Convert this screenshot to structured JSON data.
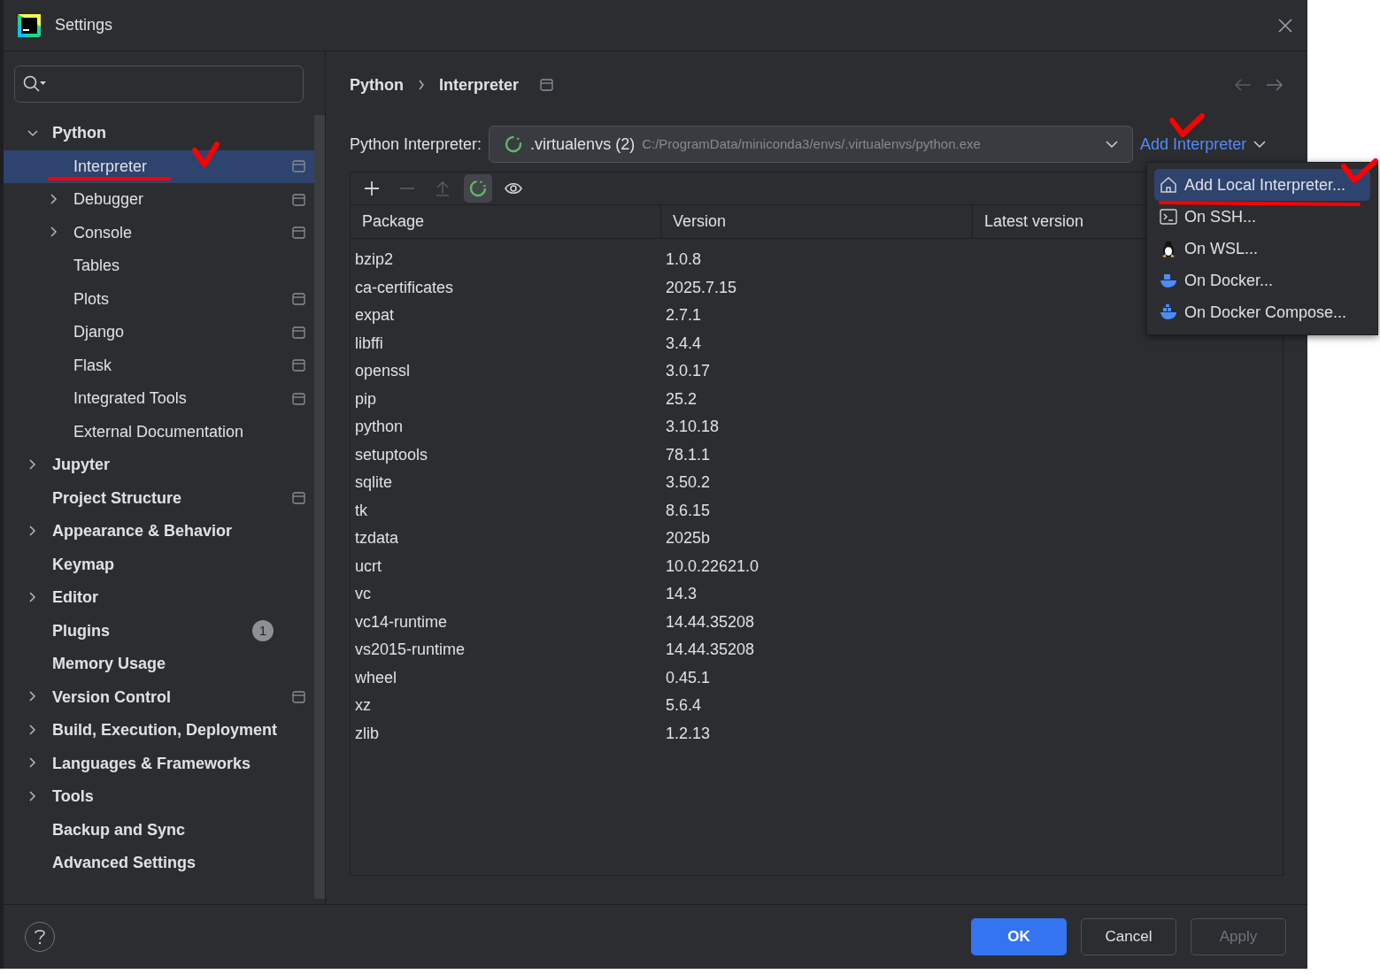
{
  "window": {
    "title": "Settings"
  },
  "sidebar": {
    "items": [
      {
        "label": "Python",
        "selected": false,
        "expanded": true,
        "project": false,
        "children": [
          {
            "label": "Interpreter",
            "selected": true,
            "project": true
          },
          {
            "label": "Debugger",
            "selected": false,
            "expanded": false,
            "project": true
          },
          {
            "label": "Console",
            "selected": false,
            "expanded": false,
            "project": true
          },
          {
            "label": "Tables",
            "selected": false,
            "project": false
          },
          {
            "label": "Plots",
            "selected": false,
            "project": true
          },
          {
            "label": "Django",
            "selected": false,
            "project": true
          },
          {
            "label": "Flask",
            "selected": false,
            "project": true
          },
          {
            "label": "Integrated Tools",
            "selected": false,
            "project": true
          },
          {
            "label": "External Documentation",
            "selected": false,
            "project": false
          }
        ]
      },
      {
        "label": "Jupyter",
        "selected": false,
        "expanded": false,
        "project": false
      },
      {
        "label": "Project Structure",
        "selected": false,
        "project": true
      },
      {
        "label": "Appearance & Behavior",
        "selected": false,
        "expanded": false,
        "project": false
      },
      {
        "label": "Keymap",
        "selected": false,
        "project": false
      },
      {
        "label": "Editor",
        "selected": false,
        "expanded": false,
        "project": false
      },
      {
        "label": "Plugins",
        "selected": false,
        "project": false,
        "badge": "1"
      },
      {
        "label": "Memory Usage",
        "selected": false,
        "project": false
      },
      {
        "label": "Version Control",
        "selected": false,
        "expanded": false,
        "project": true
      },
      {
        "label": "Build, Execution, Deployment",
        "selected": false,
        "expanded": false,
        "project": false
      },
      {
        "label": "Languages & Frameworks",
        "selected": false,
        "expanded": false,
        "project": false
      },
      {
        "label": "Tools",
        "selected": false,
        "expanded": false,
        "project": false
      },
      {
        "label": "Backup and Sync",
        "selected": false,
        "project": false
      },
      {
        "label": "Advanced Settings",
        "selected": false,
        "project": false
      }
    ]
  },
  "breadcrumb": [
    "Python",
    "Interpreter"
  ],
  "interpreter": {
    "label": "Python Interpreter:",
    "name": ".virtualenvs (2)",
    "path": "C:/ProgramData/miniconda3/envs/.virtualenvs/python.exe"
  },
  "add_interpreter": {
    "label": "Add Interpreter",
    "expanded": true
  },
  "menu": [
    {
      "kind": "home",
      "label": "Add Local Interpreter...",
      "selected": true
    },
    {
      "kind": "terminal",
      "label": "On SSH...",
      "selected": false
    },
    {
      "kind": "linux",
      "label": "On WSL...",
      "selected": false
    },
    {
      "kind": "docker",
      "label": "On Docker...",
      "selected": false
    },
    {
      "kind": "compose",
      "label": "On Docker Compose...",
      "selected": false
    }
  ],
  "toolbar": [
    {
      "kind": "add",
      "disabled": false,
      "on": false
    },
    {
      "kind": "remove",
      "disabled": true,
      "on": false
    },
    {
      "kind": "upgrade",
      "disabled": true,
      "on": false
    },
    {
      "kind": "refresh",
      "disabled": false,
      "on": true
    },
    {
      "kind": "eye",
      "disabled": false,
      "on": false
    }
  ],
  "table": {
    "columns": [
      "Package",
      "Version",
      "Latest version"
    ],
    "rows": [
      [
        "bzip2",
        "1.0.8"
      ],
      [
        "ca-certificates",
        "2025.7.15"
      ],
      [
        "expat",
        "2.7.1"
      ],
      [
        "libffi",
        "3.4.4"
      ],
      [
        "openssl",
        "3.0.17"
      ],
      [
        "pip",
        "25.2"
      ],
      [
        "python",
        "3.10.18"
      ],
      [
        "setuptools",
        "78.1.1"
      ],
      [
        "sqlite",
        "3.50.2"
      ],
      [
        "tk",
        "8.6.15"
      ],
      [
        "tzdata",
        "2025b"
      ],
      [
        "ucrt",
        "10.0.22621.0"
      ],
      [
        "vc",
        "14.3"
      ],
      [
        "vc14-runtime",
        "14.44.35208"
      ],
      [
        "vs2015-runtime",
        "14.44.35208"
      ],
      [
        "wheel",
        "0.45.1"
      ],
      [
        "xz",
        "5.6.4"
      ],
      [
        "zlib",
        "1.2.13"
      ]
    ]
  },
  "buttons": [
    {
      "label": "OK",
      "kind": "primary",
      "disabled": false
    },
    {
      "label": "Cancel",
      "kind": "default",
      "disabled": false
    },
    {
      "label": "Apply",
      "kind": "default",
      "disabled": true
    }
  ]
}
